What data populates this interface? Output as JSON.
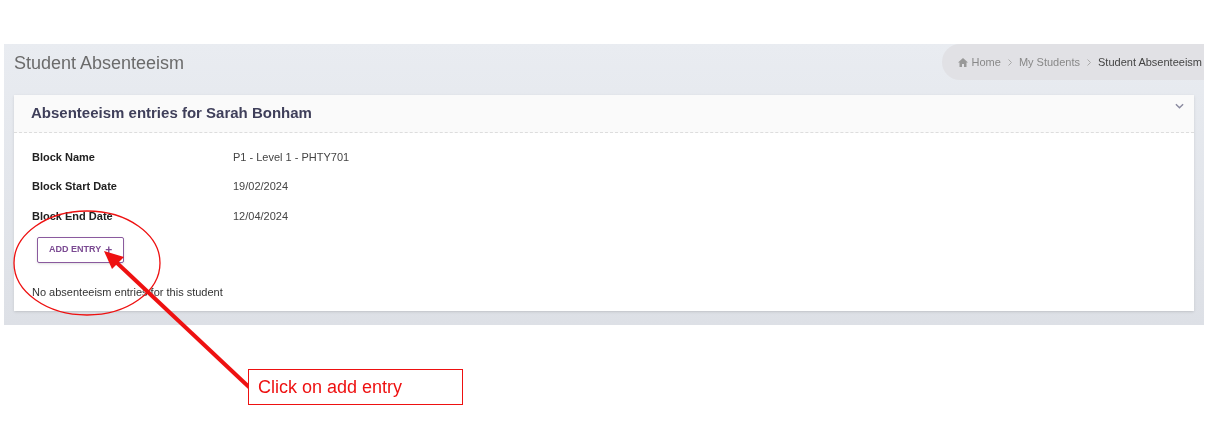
{
  "page_title": "Student Absenteeism",
  "breadcrumb": [
    {
      "label": "Home",
      "kind": "home"
    },
    {
      "label": "My Students",
      "kind": "link"
    },
    {
      "label": "Student Absenteeism",
      "kind": "current"
    }
  ],
  "card": {
    "title": "Absenteeism entries for Sarah Bonham",
    "expanded": true,
    "fields": [
      {
        "label": "Block Name",
        "value": "P1 - Level 1 - PHTY701"
      },
      {
        "label": "Block Start Date",
        "value": "19/02/2024"
      },
      {
        "label": "Block End Date",
        "value": "12/04/2024"
      }
    ],
    "add_button": {
      "label": "ADD ENTRY",
      "icon": "+"
    },
    "empty_message": "No absenteeism entries for this student"
  },
  "annotation": {
    "callout": "Click on add entry"
  }
}
